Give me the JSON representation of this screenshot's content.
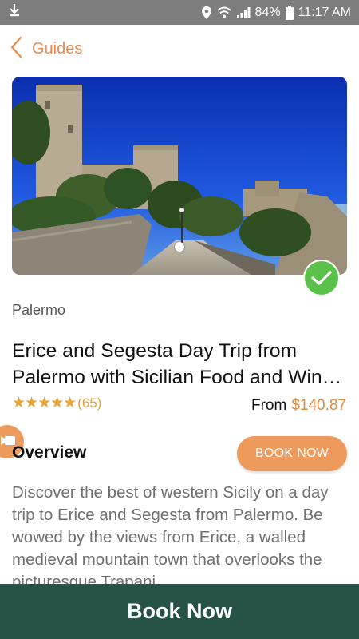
{
  "status_bar": {
    "battery": "84%",
    "time": "11:17 AM",
    "icons": [
      "download-icon",
      "location-icon",
      "wifi-icon",
      "signal-icon",
      "battery-icon"
    ]
  },
  "header": {
    "back_label": "Guides",
    "back_icon": "chevron-left-icon"
  },
  "hero": {
    "image_subject": "Castle of Venus, Erice",
    "verified_icon": "checkmark-icon"
  },
  "tour": {
    "city": "Palermo",
    "title_line1": "Erice and Segesta Day Trip from",
    "title_line2": "Palermo with Sicilian Food and Wine Tasting",
    "stars": "★★★★★",
    "rating": 5,
    "review_count": "(65)",
    "price_prefix": "From",
    "price": "$140.87"
  },
  "overview": {
    "heading": "Overview",
    "book_button": "BOOK NOW",
    "description": "Discover the best of western Sicily on a day trip to Erice and Segesta from Palermo. Be wowed by the views from Erice, a walled medieval mountain town that overlooks the picturesque Trapani"
  },
  "bottom_bar": {
    "label": "Book Now"
  },
  "colors": {
    "accent": "#ee9a5d",
    "price": "#e08a3f",
    "stars": "#e3a33a",
    "bottom_bar": "#265247",
    "check": "#5ac14a"
  }
}
